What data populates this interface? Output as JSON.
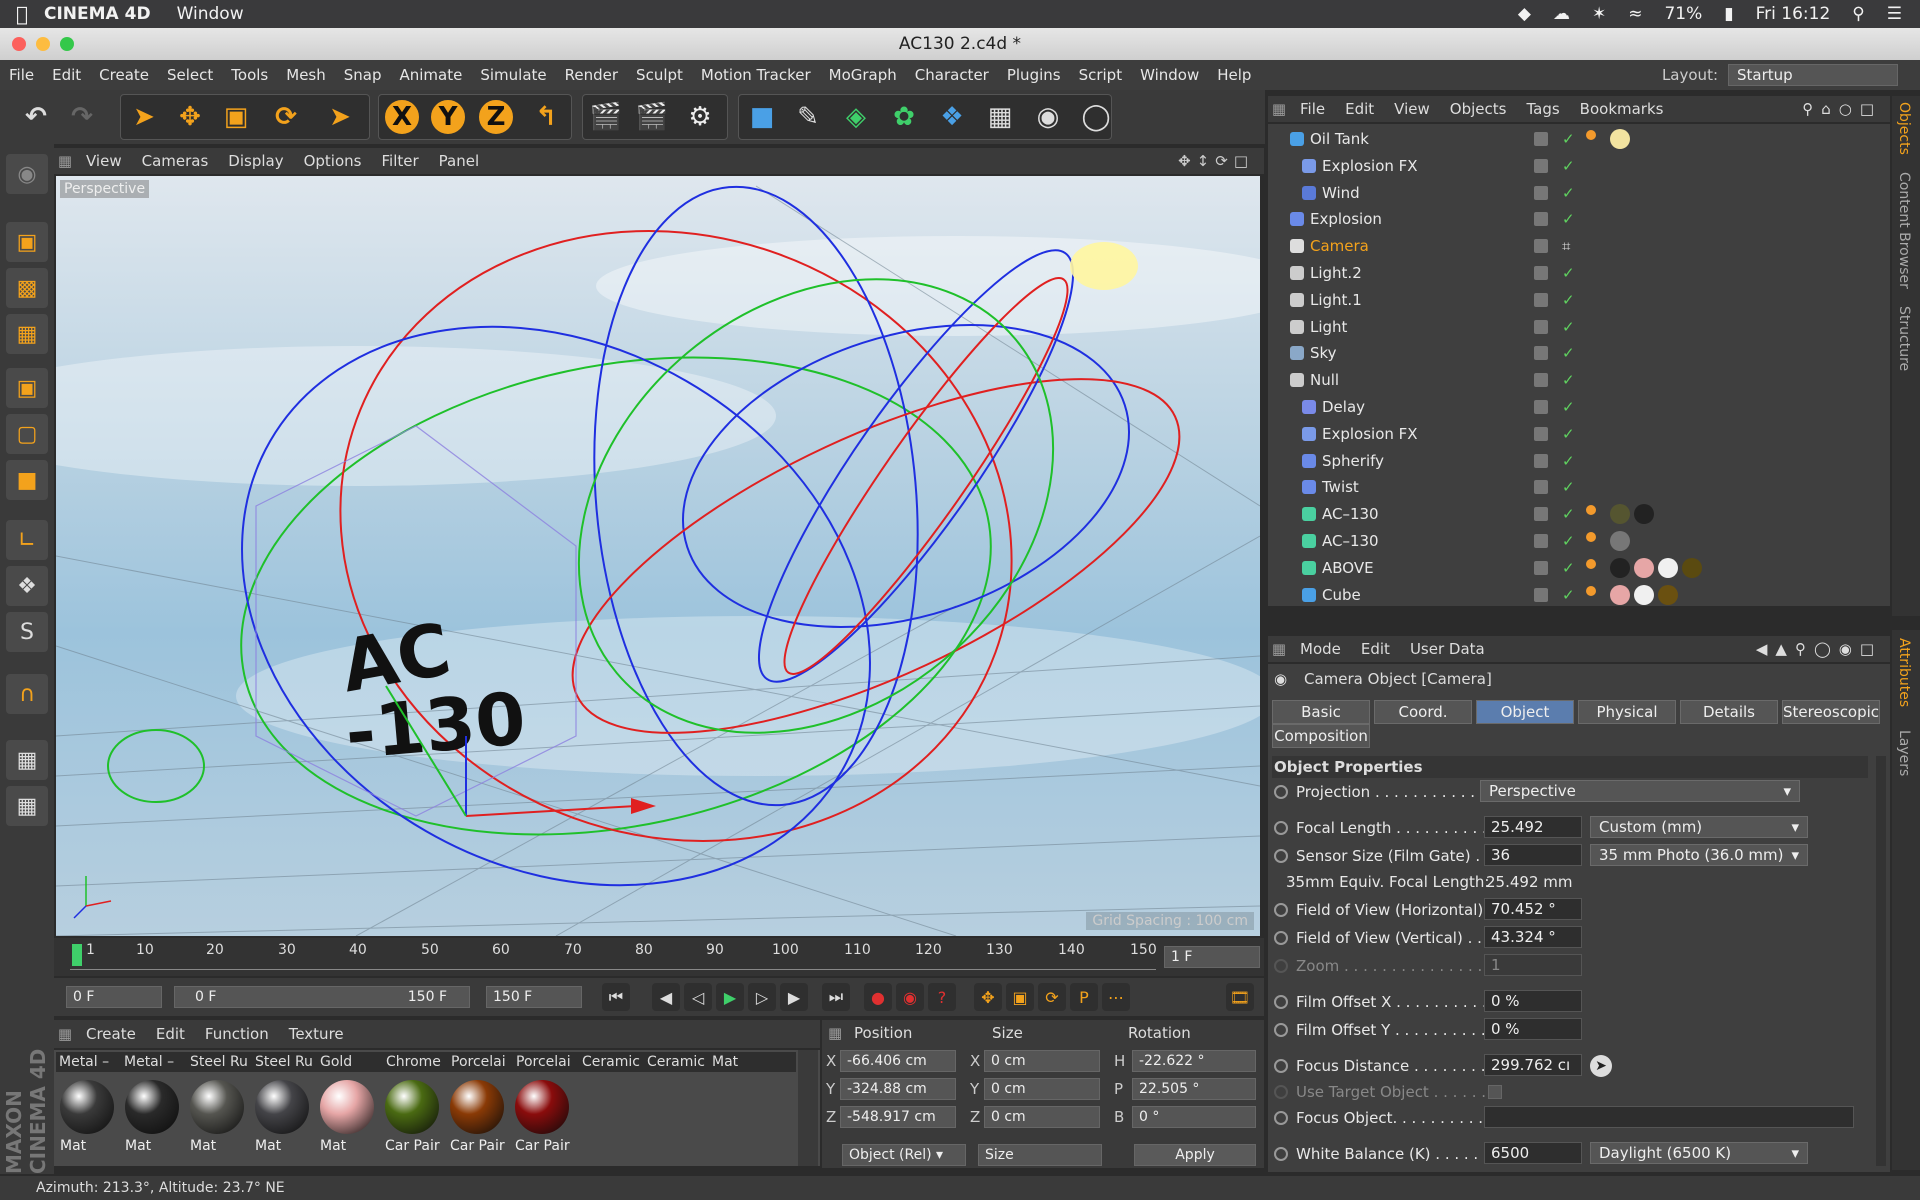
{
  "macbar": {
    "app_name": "CINEMA 4D",
    "menu": [
      "Window"
    ],
    "battery": "71%",
    "clock": "Fri 16:12"
  },
  "window": {
    "title": "AC130 2.c4d *"
  },
  "menubar": {
    "items": [
      "File",
      "Edit",
      "Create",
      "Select",
      "Tools",
      "Mesh",
      "Snap",
      "Animate",
      "Simulate",
      "Render",
      "Sculpt",
      "Motion Tracker",
      "MoGraph",
      "Character",
      "Plugins",
      "Script",
      "Window",
      "Help"
    ],
    "layout_label": "Layout:",
    "layout_value": "Startup"
  },
  "toolbar": {
    "axis_x": "X",
    "axis_y": "Y",
    "axis_z": "Z"
  },
  "viewport": {
    "menu": [
      "View",
      "Cameras",
      "Display",
      "Options",
      "Filter",
      "Panel"
    ],
    "label": "Perspective",
    "grid_spacing": "Grid Spacing : 100 cm"
  },
  "timeline": {
    "ticks": [
      "1",
      "10",
      "20",
      "30",
      "40",
      "50",
      "60",
      "70",
      "80",
      "90",
      "100",
      "110",
      "120",
      "130",
      "140",
      "150"
    ],
    "current_frame": "1 F",
    "start": "0 F",
    "range_start": "0 F",
    "range_end": "150 F",
    "end": "150 F"
  },
  "materials": {
    "menu": [
      "Create",
      "Edit",
      "Function",
      "Texture"
    ],
    "names": [
      "Metal –",
      "Metal –",
      "Steel Ru",
      "Steel Ru",
      "Gold",
      "Chrome",
      "Porcelai",
      "Porcelai",
      "Ceramic",
      "Ceramic",
      "Mat"
    ],
    "items": [
      {
        "label": "Mat",
        "color": "#3a3a3a"
      },
      {
        "label": "Mat",
        "color": "#2a2a2a"
      },
      {
        "label": "Mat",
        "color": "#555550"
      },
      {
        "label": "Mat",
        "color": "#444448"
      },
      {
        "label": "Mat",
        "color": "#e6a6a6"
      },
      {
        "label": "Car Pair",
        "color": "#4a6a12"
      },
      {
        "label": "Car Pair",
        "color": "#8a3a06"
      },
      {
        "label": "Car Pair",
        "color": "#8a0c0c"
      }
    ]
  },
  "coordinates": {
    "headers": [
      "Position",
      "Size",
      "Rotation"
    ],
    "rows": [
      {
        "axis": "X",
        "pos": "-66.406 cm",
        "size_axis": "X",
        "size": "0 cm",
        "rot_axis": "H",
        "rot": "-22.622 °"
      },
      {
        "axis": "Y",
        "pos": "-324.88 cm",
        "size_axis": "Y",
        "size": "0 cm",
        "rot_axis": "P",
        "rot": "22.505 °"
      },
      {
        "axis": "Z",
        "pos": "-548.917 cm",
        "size_axis": "Z",
        "size": "0 cm",
        "rot_axis": "B",
        "rot": "0 °"
      }
    ],
    "mode": "Object (Rel)",
    "size_mode": "Size",
    "apply": "Apply"
  },
  "status": {
    "text": "Azimuth: 213.3°, Altitude: 23.7°  NE"
  },
  "objects": {
    "menu": [
      "File",
      "Edit",
      "View",
      "Objects",
      "Tags",
      "Bookmarks"
    ],
    "items": [
      {
        "name": "Oil Tank",
        "indent": 0,
        "icon": "#4aa0e6"
      },
      {
        "name": "Explosion FX",
        "indent": 1,
        "icon": "#7a9ae8"
      },
      {
        "name": "Wind",
        "indent": 1,
        "icon": "#5a7ad8"
      },
      {
        "name": "Explosion",
        "indent": 0,
        "icon": "#6a8ae8"
      },
      {
        "name": "Camera",
        "indent": 0,
        "icon": "#dddddd"
      },
      {
        "name": "Light.2",
        "indent": 0,
        "icon": "#cccccc"
      },
      {
        "name": "Light.1",
        "indent": 0,
        "icon": "#cccccc"
      },
      {
        "name": "Light",
        "indent": 0,
        "icon": "#cccccc"
      },
      {
        "name": "Sky",
        "indent": 0,
        "icon": "#8aa8c8"
      },
      {
        "name": "Null",
        "indent": 0,
        "icon": "#cccccc"
      },
      {
        "name": "Delay",
        "indent": 1,
        "icon": "#7a8ae8"
      },
      {
        "name": "Explosion FX",
        "indent": 1,
        "icon": "#7a9ae8"
      },
      {
        "name": "Spherify",
        "indent": 1,
        "icon": "#6a8ae8"
      },
      {
        "name": "Twist",
        "indent": 1,
        "icon": "#6a8ae8"
      },
      {
        "name": "AC–130",
        "indent": 1,
        "icon": "#4ad0a0"
      },
      {
        "name": "AC–130",
        "indent": 1,
        "icon": "#4ad0a0"
      },
      {
        "name": "ABOVE",
        "indent": 1,
        "icon": "#4ad0a0"
      },
      {
        "name": "Cube",
        "indent": 1,
        "icon": "#4aa0e6"
      }
    ]
  },
  "side_tabs": {
    "top": [
      "Objects",
      "Content Browser",
      "Structure"
    ],
    "bottom": [
      "Attributes",
      "Layers"
    ]
  },
  "attributes": {
    "menu": [
      "Mode",
      "Edit",
      "User Data"
    ],
    "object_title": "Camera Object [Camera]",
    "tabs": [
      "Basic",
      "Coord.",
      "Object",
      "Physical",
      "Details",
      "Stereoscopic",
      "Composition"
    ],
    "active_tab": "Object",
    "section": "Object Properties",
    "projection_label": "Projection . . . . . . . . . . . . .",
    "projection_value": "Perspective",
    "focal_length_label": "Focal Length . . . . . . . . . .",
    "focal_length_value": "25.492",
    "focal_length_preset": "Custom (mm)",
    "sensor_label": "Sensor Size (Film Gate) . .",
    "sensor_value": "36",
    "sensor_preset": "35 mm Photo (36.0 mm)",
    "equiv_label": "35mm Equiv. Focal Length:",
    "equiv_value": "25.492 mm",
    "fov_h_label": "Field of View (Horizontal)",
    "fov_h_value": "70.452 °",
    "fov_v_label": "Field of View (Vertical) . .",
    "fov_v_value": "43.324 °",
    "zoom_label": "Zoom . . . . . . . . . . . . . . . . .",
    "zoom_value": "1",
    "offset_x_label": "Film Offset X . . . . . . . . . .",
    "offset_x_value": "0 %",
    "offset_y_label": "Film Offset Y . . . . . . . . . .",
    "offset_y_value": "0 %",
    "focus_dist_label": "Focus Distance . . . . . . . . .",
    "focus_dist_value": "299.762 cı",
    "use_target_label": "Use Target Object . . . . . .",
    "focus_obj_label": "Focus Object. . . . . . . . . . .",
    "wb_label": "White Balance (K) . . . . . . .",
    "wb_value": "6500",
    "wb_preset": "Daylight (6500 K)"
  }
}
